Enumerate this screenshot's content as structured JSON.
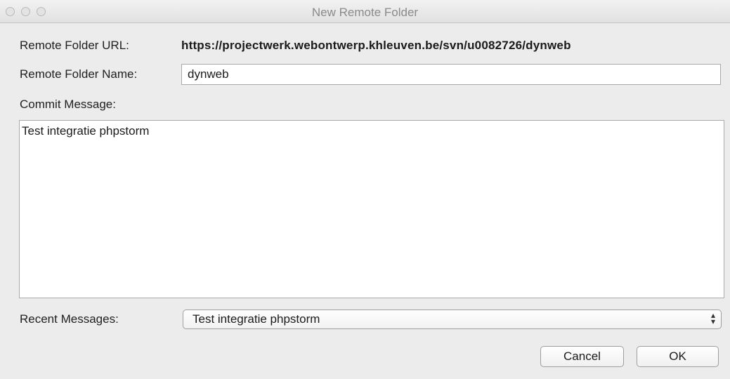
{
  "window": {
    "title": "New Remote Folder"
  },
  "form": {
    "url_label": "Remote Folder URL:",
    "url_value": "https://projectwerk.webontwerp.khleuven.be/svn/u0082726/dynweb",
    "name_label": "Remote Folder Name:",
    "name_value": "dynweb",
    "commit_label": "Commit Message:",
    "commit_value": "Test integratie phpstorm",
    "recent_label": "Recent Messages:",
    "recent_selected": "Test integratie phpstorm"
  },
  "buttons": {
    "cancel": "Cancel",
    "ok": "OK"
  }
}
